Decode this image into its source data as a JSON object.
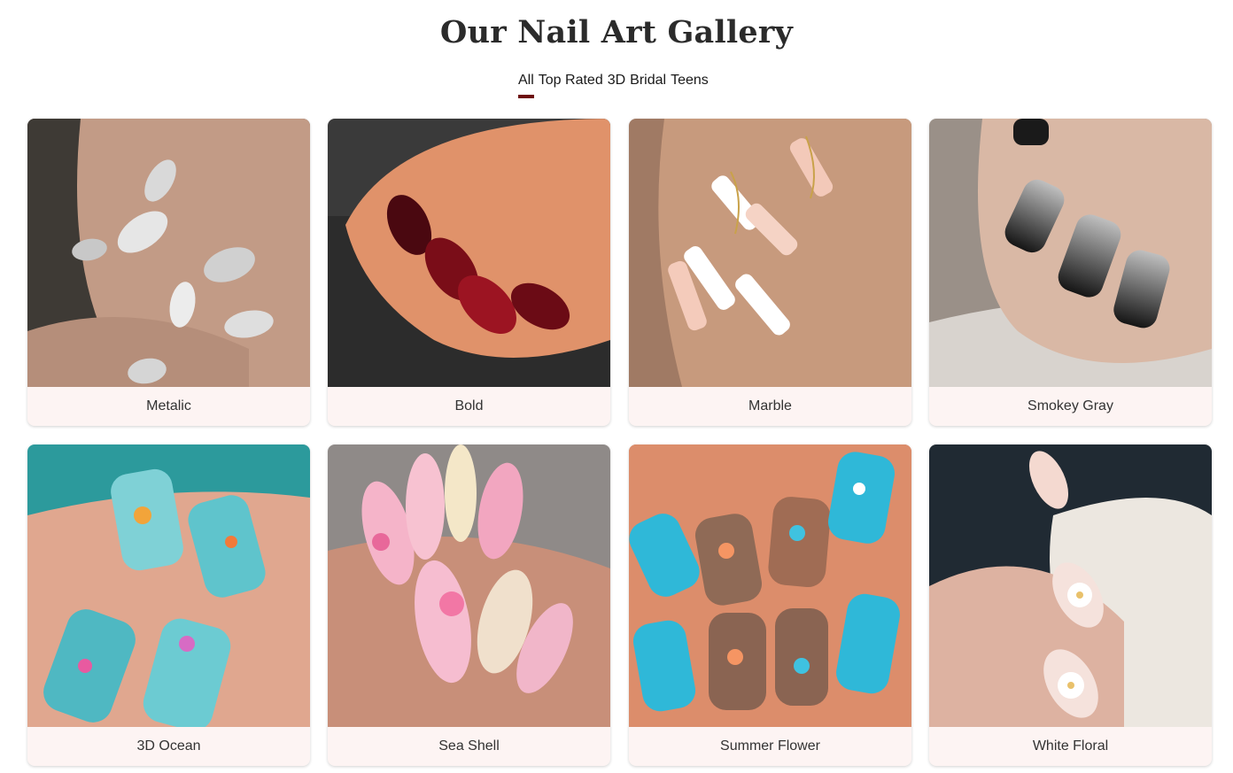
{
  "page": {
    "title": "Our Nail Art Gallery"
  },
  "filters": {
    "items": [
      "All",
      "Top Rated",
      "3D",
      "Bridal",
      "Teens"
    ],
    "active_index": 0
  },
  "gallery": {
    "cards": [
      {
        "label": "Metalic"
      },
      {
        "label": "Bold"
      },
      {
        "label": "Marble"
      },
      {
        "label": "Smokey Gray"
      },
      {
        "label": "3D Ocean"
      },
      {
        "label": "Sea Shell"
      },
      {
        "label": "Summer Flower"
      },
      {
        "label": "White Floral"
      }
    ]
  },
  "colors": {
    "accent": "#6d0d0d",
    "card_label_bg": "#fdf4f3"
  }
}
